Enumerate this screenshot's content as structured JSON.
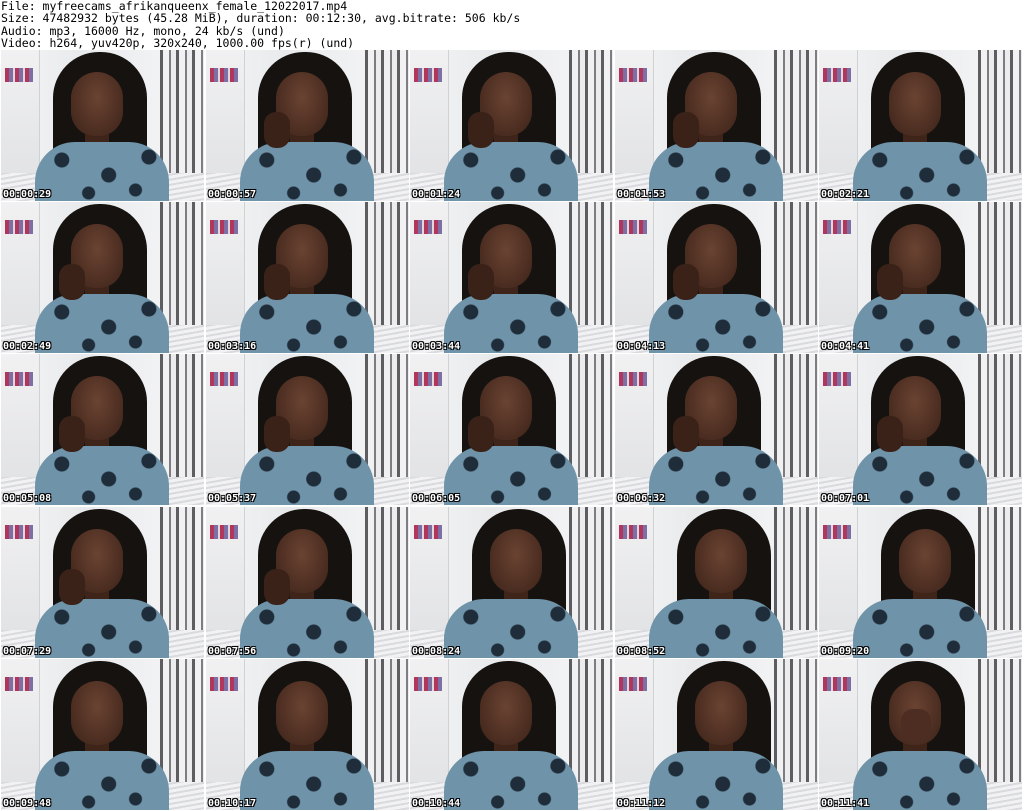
{
  "header": {
    "file_line": "File: myfreecams_afrikanqueenx_female_12022017.mp4",
    "size_line": "Size: 47482932 bytes (45.28 MiB), duration: 00:12:30, avg.bitrate: 506 kb/s",
    "audio_line": "Audio: mp3, 16000 Hz, mono, 24 kb/s (und)",
    "video_line": "Video: h264, yuv420p, 320x240, 1000.00 fps(r) (und)"
  },
  "thumbnails": [
    {
      "timestamp": "00:00:29"
    },
    {
      "timestamp": "00:00:57"
    },
    {
      "timestamp": "00:01:24"
    },
    {
      "timestamp": "00:01:53"
    },
    {
      "timestamp": "00:02:21"
    },
    {
      "timestamp": "00:02:49"
    },
    {
      "timestamp": "00:03:16"
    },
    {
      "timestamp": "00:03:44"
    },
    {
      "timestamp": "00:04:13"
    },
    {
      "timestamp": "00:04:41"
    },
    {
      "timestamp": "00:05:08"
    },
    {
      "timestamp": "00:05:37"
    },
    {
      "timestamp": "00:06:05"
    },
    {
      "timestamp": "00:06:32"
    },
    {
      "timestamp": "00:07:01"
    },
    {
      "timestamp": "00:07:29"
    },
    {
      "timestamp": "00:07:56"
    },
    {
      "timestamp": "00:08:24"
    },
    {
      "timestamp": "00:08:52"
    },
    {
      "timestamp": "00:09:20"
    },
    {
      "timestamp": "00:09:48"
    },
    {
      "timestamp": "00:10:17"
    },
    {
      "timestamp": "00:10:44"
    },
    {
      "timestamp": "00:11:12"
    },
    {
      "timestamp": "00:11:41"
    }
  ]
}
